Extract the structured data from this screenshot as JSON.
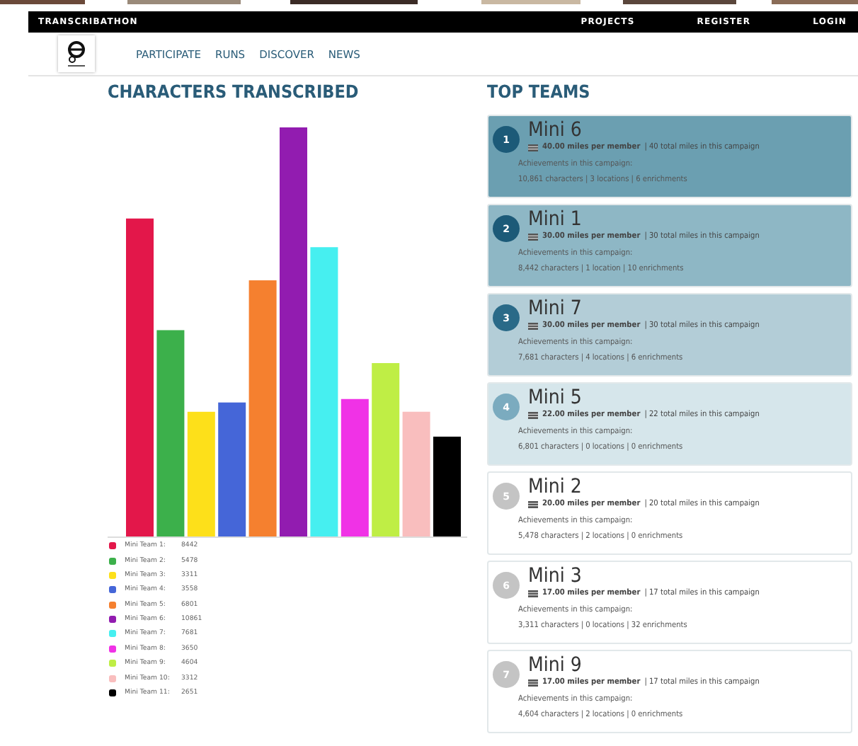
{
  "site": {
    "name": "TRANSCRIBATHON",
    "top_links": [
      "PROJECTS",
      "REGISTER",
      "LOGIN"
    ],
    "nav": [
      "PARTICIPATE",
      "RUNS",
      "DISCOVER",
      "NEWS"
    ]
  },
  "chart_section": {
    "title": "CHARACTERS TRANSCRIBED",
    "legend": [
      {
        "label": "Mini Team 1:",
        "value": "8442",
        "color": "#e3174a"
      },
      {
        "label": "Mini Team 2:",
        "value": "5478",
        "color": "#3cb04b"
      },
      {
        "label": "Mini Team 3:",
        "value": "3311",
        "color": "#fde01a"
      },
      {
        "label": "Mini Team 4:",
        "value": "3558",
        "color": "#4566d8"
      },
      {
        "label": "Mini Team 5:",
        "value": "6801",
        "color": "#f5802f"
      },
      {
        "label": "Mini Team 6:",
        "value": "10861",
        "color": "#921cb0"
      },
      {
        "label": "Mini Team 7:",
        "value": "7681",
        "color": "#46eff0"
      },
      {
        "label": "Mini Team 8:",
        "value": "3650",
        "color": "#f032e6"
      },
      {
        "label": "Mini Team 9:",
        "value": "4604",
        "color": "#bfee45"
      },
      {
        "label": "Mini Team 10:",
        "value": "3312",
        "color": "#f9bebe"
      },
      {
        "label": "Mini Team 11:",
        "value": "2651",
        "color": "#000000"
      }
    ]
  },
  "teams_section": {
    "title": "TOP TEAMS",
    "teams": [
      {
        "rank": "1",
        "name": "Mini 6",
        "miles_per_member": "40.00 miles per member",
        "total": "| 40 total miles in this campaign",
        "stats": "10,861 characters | 3 locations | 6 enrichments",
        "achievements_label": "Achievements in this campaign:",
        "color": "#6b9fb1",
        "badge": {
          "color": "#1c5a78"
        }
      },
      {
        "rank": "2",
        "name": "Mini 1",
        "miles_per_member": "30.00 miles per member",
        "total": "| 30 total miles in this campaign",
        "stats": "8,442 characters | 1 location | 10 enrichments",
        "achievements_label": "Achievements in this campaign:",
        "color": "#8eb7c5",
        "badge": {
          "color": "#1c5a78"
        }
      },
      {
        "rank": "3",
        "name": "Mini 7",
        "miles_per_member": "30.00 miles per member",
        "total": "| 30 total miles in this campaign",
        "stats": "7,681 characters | 4 locations | 6 enrichments",
        "achievements_label": "Achievements in this campaign:",
        "color": "#b3cdd7",
        "badge": {
          "color": "#2a6a88"
        }
      },
      {
        "rank": "4",
        "name": "Mini 5",
        "miles_per_member": "22.00 miles per member",
        "total": "| 22 total miles in this campaign",
        "stats": "6,801 characters | 0 locations | 0 enrichments",
        "achievements_label": "Achievements in this campaign:",
        "color": "#d6e6eb",
        "badge": {
          "color": "#7babbf"
        }
      },
      {
        "rank": "5",
        "name": "Mini 2",
        "miles_per_member": "20.00 miles per member",
        "total": "| 20 total miles in this campaign",
        "stats": "5,478 characters | 2 locations | 0 enrichments",
        "achievements_label": "Achievements in this campaign:",
        "color": "#ffffff",
        "badge": {
          "color": "#c4c4c4"
        }
      },
      {
        "rank": "6",
        "name": "Mini 3",
        "miles_per_member": "17.00 miles per member",
        "total": "| 17 total miles in this campaign",
        "stats": "3,311 characters | 0 locations | 32 enrichments",
        "achievements_label": "Achievements in this campaign:",
        "color": "#ffffff",
        "badge": {
          "color": "#c4c4c4"
        }
      },
      {
        "rank": "7",
        "name": "Mini 9",
        "miles_per_member": "17.00 miles per member",
        "total": "| 17 total miles in this campaign",
        "stats": "4,604 characters | 2 locations | 0 enrichments",
        "achievements_label": "Achievements in this campaign:",
        "color": "#ffffff",
        "badge": {
          "color": "#c4c4c4"
        }
      }
    ]
  }
}
